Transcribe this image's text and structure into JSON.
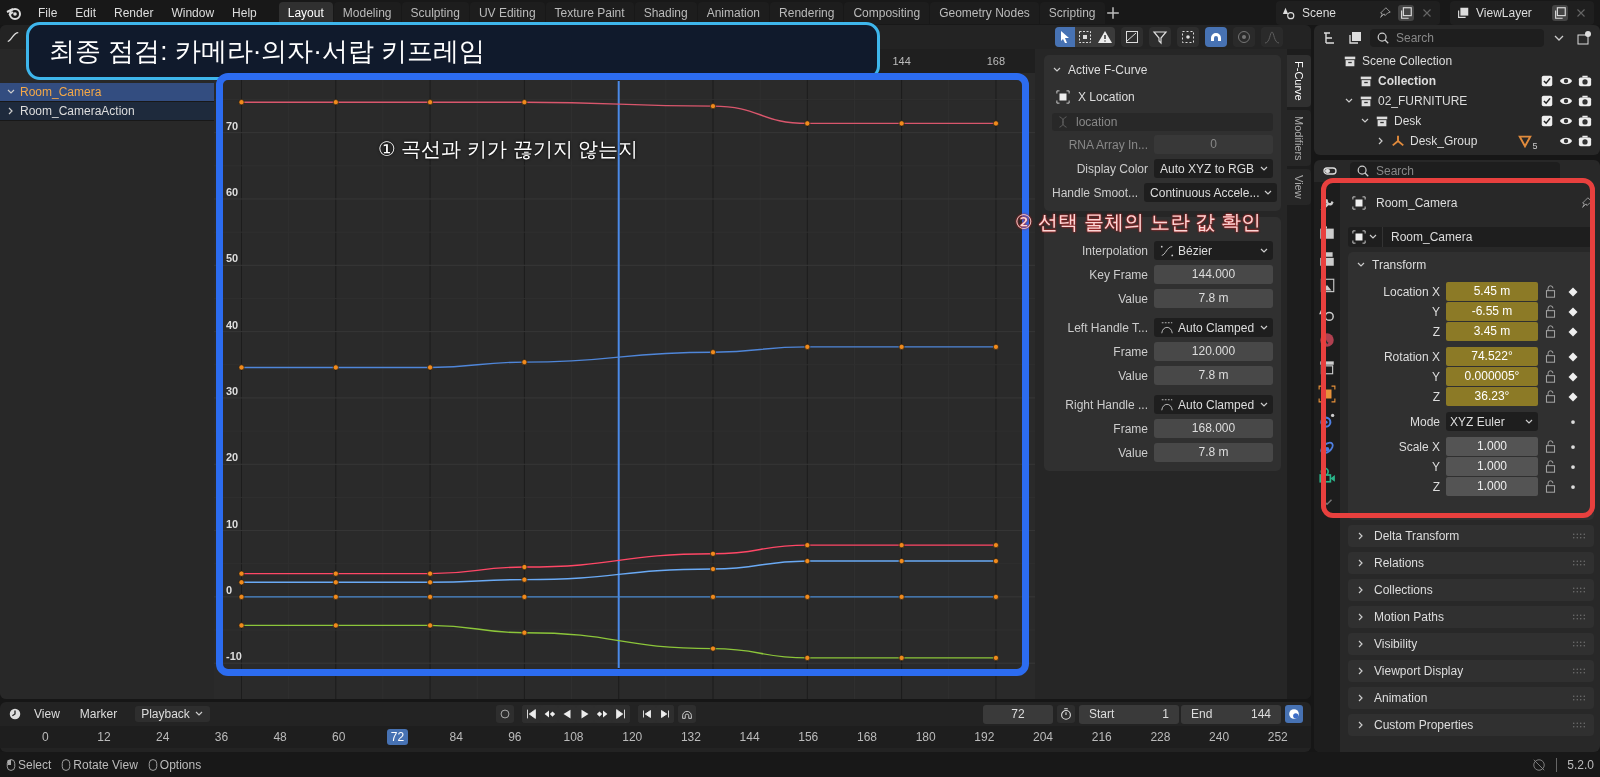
{
  "top_bar": {
    "menus": [
      "File",
      "Edit",
      "Render",
      "Window",
      "Help"
    ],
    "workspaces": [
      {
        "label": "Layout",
        "selected": true
      },
      {
        "label": "Modeling",
        "selected": false
      },
      {
        "label": "Sculpting",
        "selected": false
      },
      {
        "label": "UV Editing",
        "selected": false
      },
      {
        "label": "Texture Paint",
        "selected": false
      },
      {
        "label": "Shading",
        "selected": false
      },
      {
        "label": "Animation",
        "selected": false
      },
      {
        "label": "Rendering",
        "selected": false
      },
      {
        "label": "Compositing",
        "selected": false
      },
      {
        "label": "Geometry Nodes",
        "selected": false
      },
      {
        "label": "Scripting",
        "selected": false
      }
    ],
    "scene": "Scene",
    "view_layer": "ViewLayer"
  },
  "annotations": {
    "title": "최종 점검: 카메라·의자·서랍 키프레임",
    "notes": [
      {
        "text": "① 곡선과 키가 끊기지 않는지",
        "kind": "graph"
      },
      {
        "text": "② 선택 물체의 노란 값 확인",
        "kind": "panel"
      }
    ]
  },
  "graph_editor": {
    "channels": [
      {
        "name": "Room_Camera",
        "selected": true
      },
      {
        "name": "Room_CameraAction",
        "selected": false
      }
    ],
    "chart_data": {
      "type": "line",
      "grid": true,
      "x": [
        -24,
        0,
        24,
        48,
        96,
        120,
        144,
        168
      ],
      "xlim": [
        -31,
        178
      ],
      "ylim": [
        -15.4,
        79
      ],
      "xticks": [
        144,
        168
      ],
      "yticks": [
        -10,
        0,
        10,
        20,
        30,
        40,
        50,
        60,
        70
      ],
      "ref_lines": [
        {
          "axis": "x",
          "value": 72,
          "color": "#4b8ae8"
        }
      ],
      "series": [
        {
          "color": "#d9566c",
          "marker": "o",
          "values": [
            74.6,
            74.6,
            74.6,
            74.6,
            74.0,
            71.4,
            71.4,
            71.4
          ]
        },
        {
          "color": "#4f86d9",
          "marker": "o",
          "values": [
            34.6,
            34.6,
            34.6,
            35.4,
            36.9,
            37.7,
            37.7,
            37.7
          ]
        },
        {
          "color": "#ff4766",
          "marker": "o",
          "values": [
            3.5,
            3.5,
            3.5,
            4.5,
            6.5,
            7.8,
            7.8,
            7.8
          ]
        },
        {
          "color": "#6aaaf5",
          "marker": "o",
          "values": [
            2.2,
            2.2,
            2.2,
            2.6,
            4.2,
            5.4,
            5.4,
            5.4
          ]
        },
        {
          "color": "#4a8ad0",
          "marker": "o",
          "values": [
            0,
            0,
            0,
            0,
            0,
            0,
            0,
            0
          ]
        },
        {
          "color": "#8cc63a",
          "marker": "o",
          "values": [
            -4.3,
            -4.3,
            -4.3,
            -5.4,
            -7.8,
            -9.2,
            -9.2,
            -9.2
          ]
        }
      ]
    },
    "sidebar": {
      "fcurve_panel": {
        "title": "Active F-Curve",
        "channel": "X Location",
        "data_path": "location",
        "rows": [
          {
            "label": "RNA Array In...",
            "value": "0",
            "kind": "number",
            "disabled": true
          },
          {
            "label": "Display Color",
            "value": "Auto XYZ to RGB",
            "kind": "dropdown",
            "disabled": false
          },
          {
            "label": "Handle Smoot...",
            "value": "Continuous Accele...",
            "kind": "dropdown",
            "disabled": false
          }
        ]
      },
      "keyframe_panel": {
        "rows": [
          {
            "label": "Interpolation",
            "value": "Bézier",
            "kind": "dropdown"
          },
          {
            "label": "Key Frame",
            "value": "144.000",
            "kind": "number"
          },
          {
            "label": "Value",
            "value": "7.8 m",
            "kind": "number"
          },
          {
            "label": "Left Handle T...",
            "value": "Auto Clamped",
            "kind": "dropdown"
          },
          {
            "label": "Frame",
            "value": "120.000",
            "kind": "number"
          },
          {
            "label": "Value",
            "value": "7.8 m",
            "kind": "number"
          },
          {
            "label": "Right Handle ...",
            "value": "Auto Clamped",
            "kind": "dropdown"
          },
          {
            "label": "Frame",
            "value": "168.000",
            "kind": "number"
          },
          {
            "label": "Value",
            "value": "7.8 m",
            "kind": "number"
          }
        ]
      }
    },
    "side_tabs": [
      {
        "label": "F-Curve",
        "selected": true
      },
      {
        "label": "Modifiers",
        "selected": false
      },
      {
        "label": "View",
        "selected": false
      }
    ]
  },
  "outliner": {
    "search_placeholder": "Search",
    "items": [
      {
        "name": "Scene Collection",
        "kind": "scene",
        "children": [
          {
            "name": "Collection",
            "kind": "collection",
            "checked": true
          },
          {
            "name": "02_FURNITURE",
            "kind": "collection",
            "checked": true,
            "expanded": true,
            "children": [
              {
                "name": "Desk",
                "kind": "collection",
                "checked": true,
                "expanded": true,
                "children": [
                  {
                    "name": "Desk_Group",
                    "kind": "empty",
                    "expanded": false,
                    "badge": "5"
                  }
                ]
              }
            ]
          }
        ]
      }
    ]
  },
  "properties": {
    "search_placeholder": "Search",
    "object_name": "Room_Camera",
    "datablock": "Room_Camera",
    "transform": {
      "title": "Transform",
      "groups": [
        {
          "rows": [
            {
              "label": "Location X",
              "value": "5.45 m",
              "kind": "number",
              "animated": true
            },
            {
              "label": "Y",
              "value": "-6.55 m",
              "kind": "number",
              "animated": true
            },
            {
              "label": "Z",
              "value": "3.45 m",
              "kind": "number",
              "animated": true
            }
          ]
        },
        {
          "rows": [
            {
              "label": "Rotation X",
              "value": "74.522°",
              "kind": "number",
              "animated": true
            },
            {
              "label": "Y",
              "value": "0.000005°",
              "kind": "number",
              "animated": true
            },
            {
              "label": "Z",
              "value": "36.23°",
              "kind": "number",
              "animated": true
            }
          ]
        },
        {
          "rows": [
            {
              "label": "Mode",
              "value": "XYZ Euler",
              "kind": "dropdown",
              "animated": false
            }
          ]
        },
        {
          "rows": [
            {
              "label": "Scale X",
              "value": "1.000",
              "kind": "number",
              "animated": false
            },
            {
              "label": "Y",
              "value": "1.000",
              "kind": "number",
              "animated": false
            },
            {
              "label": "Z",
              "value": "1.000",
              "kind": "number",
              "animated": false
            }
          ]
        }
      ]
    },
    "panels": [
      "Delta Transform",
      "Relations",
      "Collections",
      "Motion Paths",
      "Visibility",
      "Viewport Display",
      "Animation",
      "Custom Properties"
    ]
  },
  "timeline": {
    "menus": [
      "View",
      "Marker"
    ],
    "playback": "Playback",
    "current_frame": "72",
    "start_label": "Start",
    "start": "1",
    "end_label": "End",
    "end": "144",
    "frames": [
      {
        "label": "0",
        "selected": false
      },
      {
        "label": "12",
        "selected": false
      },
      {
        "label": "24",
        "selected": false
      },
      {
        "label": "36",
        "selected": false
      },
      {
        "label": "48",
        "selected": false
      },
      {
        "label": "60",
        "selected": false
      },
      {
        "label": "72",
        "selected": true
      },
      {
        "label": "84",
        "selected": false
      },
      {
        "label": "96",
        "selected": false
      },
      {
        "label": "108",
        "selected": false
      },
      {
        "label": "120",
        "selected": false
      },
      {
        "label": "132",
        "selected": false
      },
      {
        "label": "144",
        "selected": false
      },
      {
        "label": "156",
        "selected": false
      },
      {
        "label": "168",
        "selected": false
      },
      {
        "label": "180",
        "selected": false
      },
      {
        "label": "192",
        "selected": false
      },
      {
        "label": "204",
        "selected": false
      },
      {
        "label": "216",
        "selected": false
      },
      {
        "label": "228",
        "selected": false
      },
      {
        "label": "240",
        "selected": false
      },
      {
        "label": "252",
        "selected": false
      }
    ]
  },
  "status_bar": {
    "hints": [
      "Select",
      "Rotate View",
      "Options"
    ],
    "version": "5.2.0"
  }
}
